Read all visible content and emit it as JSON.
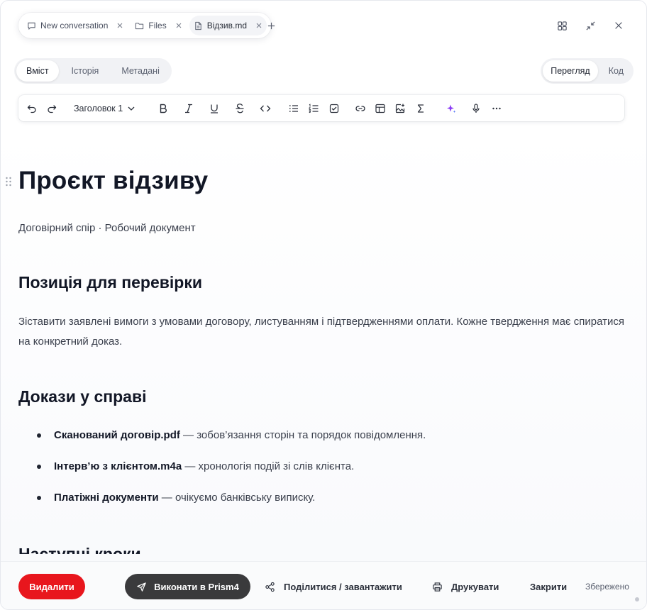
{
  "tabs": [
    {
      "label": "New conversation",
      "icon": "chat-bubble-icon"
    },
    {
      "label": "Files",
      "icon": "folder-icon"
    },
    {
      "label": "Відзив.md",
      "icon": "document-icon",
      "active": true
    }
  ],
  "section_tabs": {
    "content": "Вміст",
    "history": "Історія",
    "metadata": "Метадані"
  },
  "view_modes": {
    "preview": "Перегляд",
    "code": "Код"
  },
  "toolbar": {
    "heading_select": "Заголовок 1"
  },
  "document": {
    "title": "Проєкт відзиву",
    "subtitle": "Договірний спір · Робочий документ",
    "section1_heading": "Позиція для перевірки",
    "section1_text": "Зіставити заявлені вимоги з умовами договору, листуванням і підтвердженнями оплати. Кожне твердження має спиратися на конкретний доказ.",
    "section2_heading": "Докази у справі",
    "evidence": [
      {
        "name": "Сканований договір.pdf",
        "desc": " — зобов’язання сторін та порядок повідомлення."
      },
      {
        "name": "Інтерв’ю з клієнтом.m4a",
        "desc": " — хронологія подій зі слів клієнта."
      },
      {
        "name": "Платіжні документи",
        "desc": " — очікуємо банківську виписку."
      }
    ],
    "section3_heading": "Наступні кроки"
  },
  "footer": {
    "delete": "Видалити",
    "run": "Виконати в Prism4",
    "share": "Поділитися / завантажити",
    "print": "Друкувати",
    "close": "Закрити",
    "status": "Збережено"
  },
  "colors": {
    "danger": "#e8161d",
    "dark_button": "#3a3a3c",
    "ai_accent": "#8b3cf5"
  }
}
